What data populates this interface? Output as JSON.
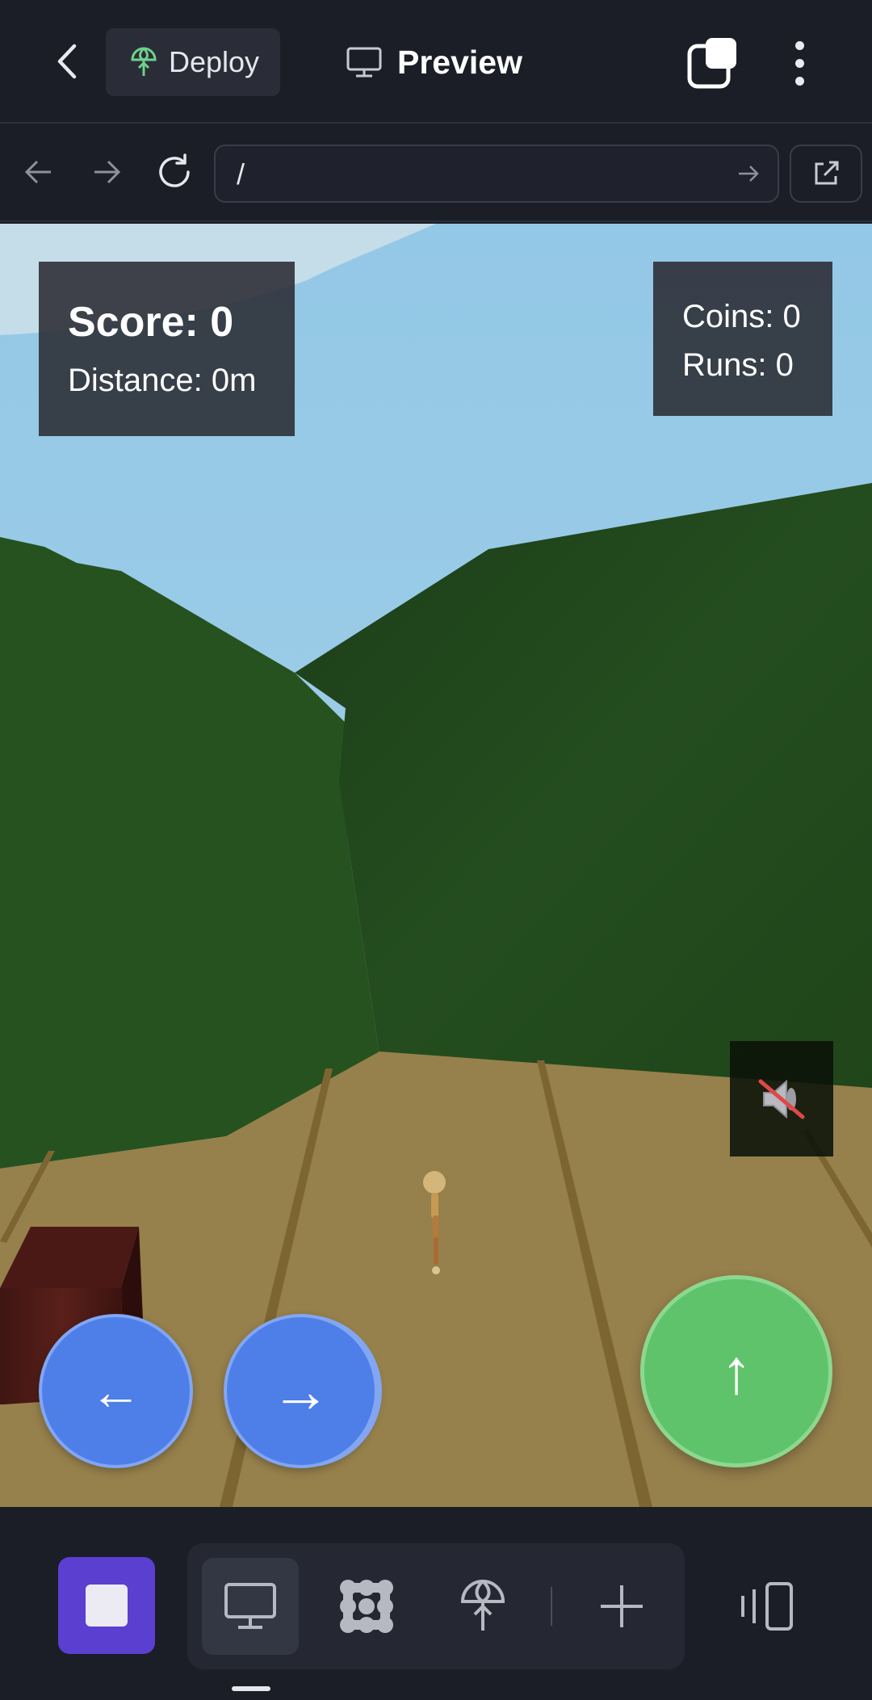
{
  "topbar": {
    "deploy_label": "Deploy",
    "preview_label": "Preview"
  },
  "urlbar": {
    "url": "/"
  },
  "hud": {
    "score": "Score: 0",
    "distance": "Distance: 0m",
    "coins": "Coins: 0",
    "runs": "Runs: 0"
  },
  "controls": {
    "left_label": "←",
    "right_label": "→",
    "jump_label": "↑"
  },
  "icons": {
    "back": "chevron-left-icon",
    "deploy": "deploy-icon",
    "preview": "monitor-icon",
    "tabs": "tabs-icon",
    "more": "more-vertical-icon",
    "nav_back": "arrow-left-icon",
    "nav_forward": "arrow-right-icon",
    "reload": "reload-icon",
    "go": "arrow-right-icon",
    "open_external": "external-link-icon",
    "sound": "speaker-muted-icon",
    "stop": "stop-icon",
    "preview_tool": "monitor-icon",
    "workflows": "workflow-icon",
    "deploy_tool": "deploy-icon",
    "add": "plus-icon",
    "device": "device-toggle-icon"
  },
  "colors": {
    "background": "#1b1d27",
    "stop_button": "#5b3fd1",
    "move_buttons": "#4e7fe9",
    "jump_button": "#5fc36b",
    "sky": "#9ccbe7",
    "hills": "#26521f",
    "ground": "#96804c",
    "deploy_icon": "#6fd08c"
  }
}
